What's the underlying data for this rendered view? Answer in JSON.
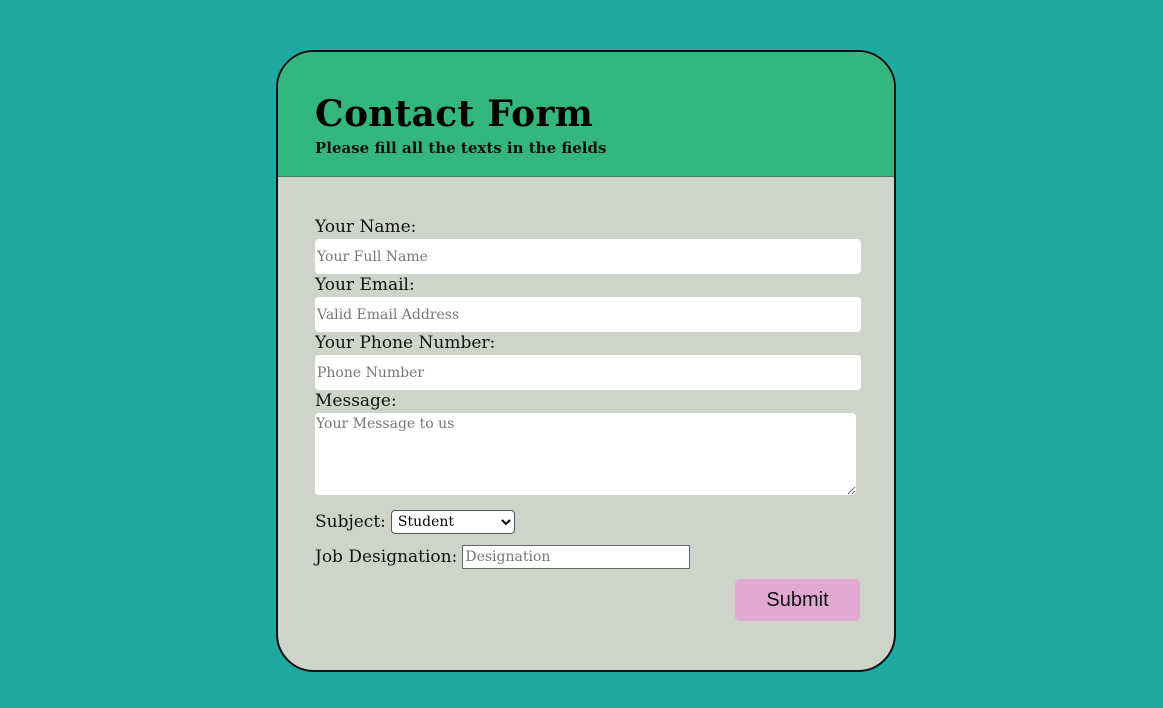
{
  "form": {
    "title": "Contact Form",
    "subtitle": "Please fill all the texts in the fields",
    "name": {
      "label": "Your Name:",
      "placeholder": "Your Full Name"
    },
    "email": {
      "label": "Your Email:",
      "placeholder": "Valid Email Address"
    },
    "phone": {
      "label": "Your Phone Number:",
      "placeholder": "Phone Number"
    },
    "message": {
      "label": "Message:",
      "placeholder": "Your Message to us"
    },
    "subject": {
      "label": "Subject:",
      "selected": "Student"
    },
    "job": {
      "label": "Job Designation:",
      "placeholder": "Designation"
    },
    "submit_label": "Submit"
  },
  "colors": {
    "page_background": "#1eaaa0",
    "header_background": "#33b77c",
    "card_background": "#cfd4ca",
    "submit_background": "#e1a9d0"
  }
}
